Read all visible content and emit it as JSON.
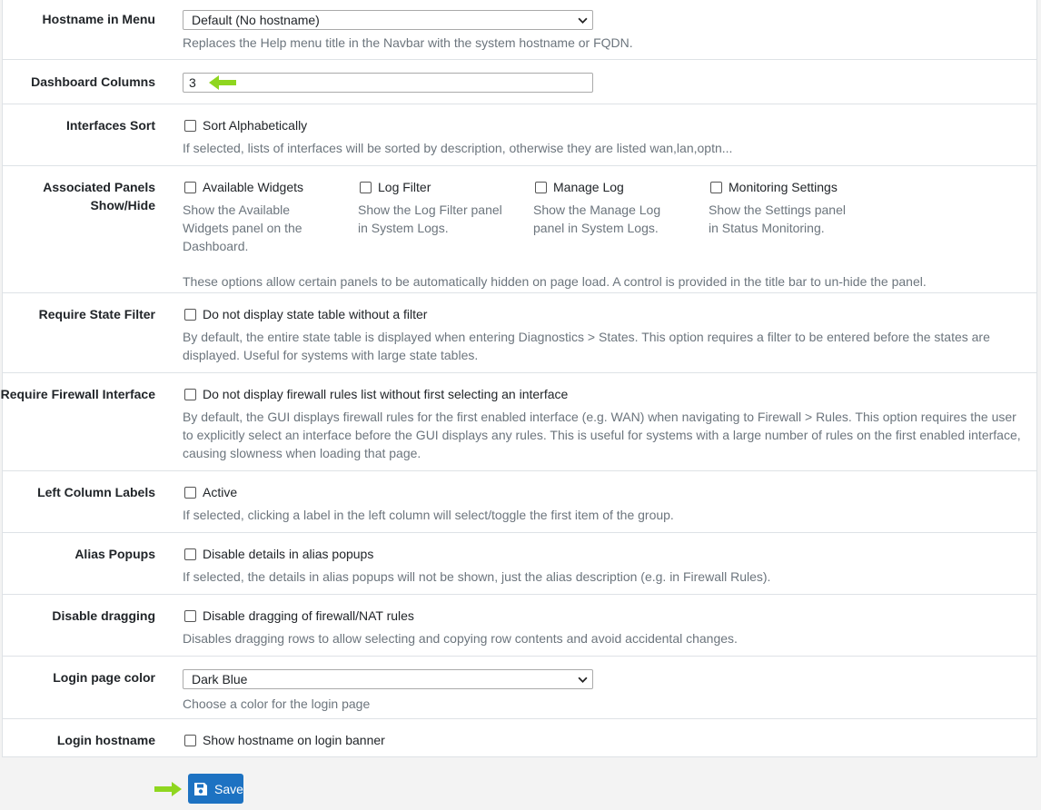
{
  "colors": {
    "accent": "#1d72c2",
    "arrow": "#8fd61f"
  },
  "rows": {
    "hostname_menu": {
      "label": "Hostname in Menu",
      "selected": "Default (No hostname)",
      "help": "Replaces the Help menu title in the Navbar with the system hostname or FQDN."
    },
    "dashboard_columns": {
      "label": "Dashboard Columns",
      "value": "3"
    },
    "interfaces_sort": {
      "label": "Interfaces Sort",
      "checkbox": "Sort Alphabetically",
      "help": "If selected, lists of interfaces will be sorted by description, otherwise they are listed wan,lan,optn..."
    },
    "associated_panels": {
      "label_line1": "Associated Panels",
      "label_line2": "Show/Hide",
      "items": [
        {
          "checkbox": "Available Widgets",
          "help": "Show the Available Widgets panel on the Dashboard."
        },
        {
          "checkbox": "Log Filter",
          "help": "Show the Log Filter panel in System Logs."
        },
        {
          "checkbox": "Manage Log",
          "help": "Show the Manage Log panel in System Logs."
        },
        {
          "checkbox": "Monitoring Settings",
          "help": "Show the Settings panel in Status Monitoring."
        }
      ],
      "help": "These options allow certain panels to be automatically hidden on page load. A control is provided in the title bar to un-hide the panel."
    },
    "require_state_filter": {
      "label": "Require State Filter",
      "checkbox": "Do not display state table without a filter",
      "help": "By default, the entire state table is displayed when entering Diagnostics > States. This option requires a filter to be entered before the states are displayed. Useful for systems with large state tables."
    },
    "require_fw_interface": {
      "label": "Require Firewall Interface",
      "checkbox": "Do not display firewall rules list without first selecting an interface",
      "help": "By default, the GUI displays firewall rules for the first enabled interface (e.g. WAN) when navigating to Firewall > Rules. This option requires the user to explicitly select an interface before the GUI displays any rules. This is useful for systems with a large number of rules on the first enabled interface, causing slowness when loading that page."
    },
    "left_column_labels": {
      "label": "Left Column Labels",
      "checkbox": "Active",
      "help": "If selected, clicking a label in the left column will select/toggle the first item of the group."
    },
    "alias_popups": {
      "label": "Alias Popups",
      "checkbox": "Disable details in alias popups",
      "help": "If selected, the details in alias popups will not be shown, just the alias description (e.g. in Firewall Rules)."
    },
    "disable_dragging": {
      "label": "Disable dragging",
      "checkbox": "Disable dragging of firewall/NAT rules",
      "help": "Disables dragging rows to allow selecting and copying row contents and avoid accidental changes."
    },
    "login_page_color": {
      "label": "Login page color",
      "selected": "Dark Blue",
      "help": "Choose a color for the login page"
    },
    "login_hostname": {
      "label": "Login hostname",
      "checkbox": "Show hostname on login banner"
    }
  },
  "save_button": {
    "label": "Save",
    "icon": "floppy-disk-icon"
  }
}
